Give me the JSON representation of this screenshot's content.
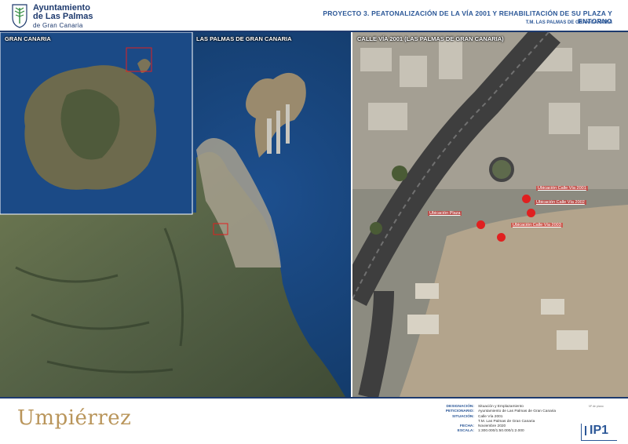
{
  "header": {
    "logo_line1": "Ayuntamiento",
    "logo_line2": "de Las Palmas",
    "logo_line3": "de Gran Canaria",
    "title": "PROYECTO 3. PEATONALIZACIÓN DE LA VÍA 2001 Y REHABILITACIÓN DE SU PLAZA Y ENTORNO",
    "subtitle": "T.M. LAS PALMAS DE GRAN CANARIA"
  },
  "panels": {
    "island_label": "GRAN CANARIA",
    "city_label": "LAS PALMAS DE GRAN CANARIA",
    "street_label": "CALLE VÍA 2001 (LAS PALMAS DE GRAN CANARIA)"
  },
  "markers": [
    {
      "label": "Ubicación Calle Vía 2001"
    },
    {
      "label": "Ubicación Calle Vía 2002"
    },
    {
      "label": "Ubicación Plaza"
    },
    {
      "label": "Ubicación Calle Vía 2003"
    }
  ],
  "colors": {
    "brand": "#b9955a",
    "accent": "#2b5797",
    "marker": "#e02020"
  },
  "footer": {
    "brand": "Umpiérrez",
    "designacion_k": "DESIGNACIÓN:",
    "designacion_v": "Situación y Emplazamiento",
    "peticionario_k": "PETICIONARIO:",
    "peticionario_v": "Ayuntamiento de Las Palmas de Gran Canaria",
    "situacion_k": "SITUACIÓN:",
    "situacion_v1": "Calle Vía 2001",
    "situacion_v2": "T.M. Las Palmas de Gran Canaria",
    "fecha_k": "FECHA:",
    "fecha_v": "Noviembre 2020",
    "escala_k": "ESCALA:",
    "escala_v": "1:300.000/1:50.000/1:2.000",
    "plan_caption": "Nº de plano",
    "plan_code": "IP1"
  }
}
